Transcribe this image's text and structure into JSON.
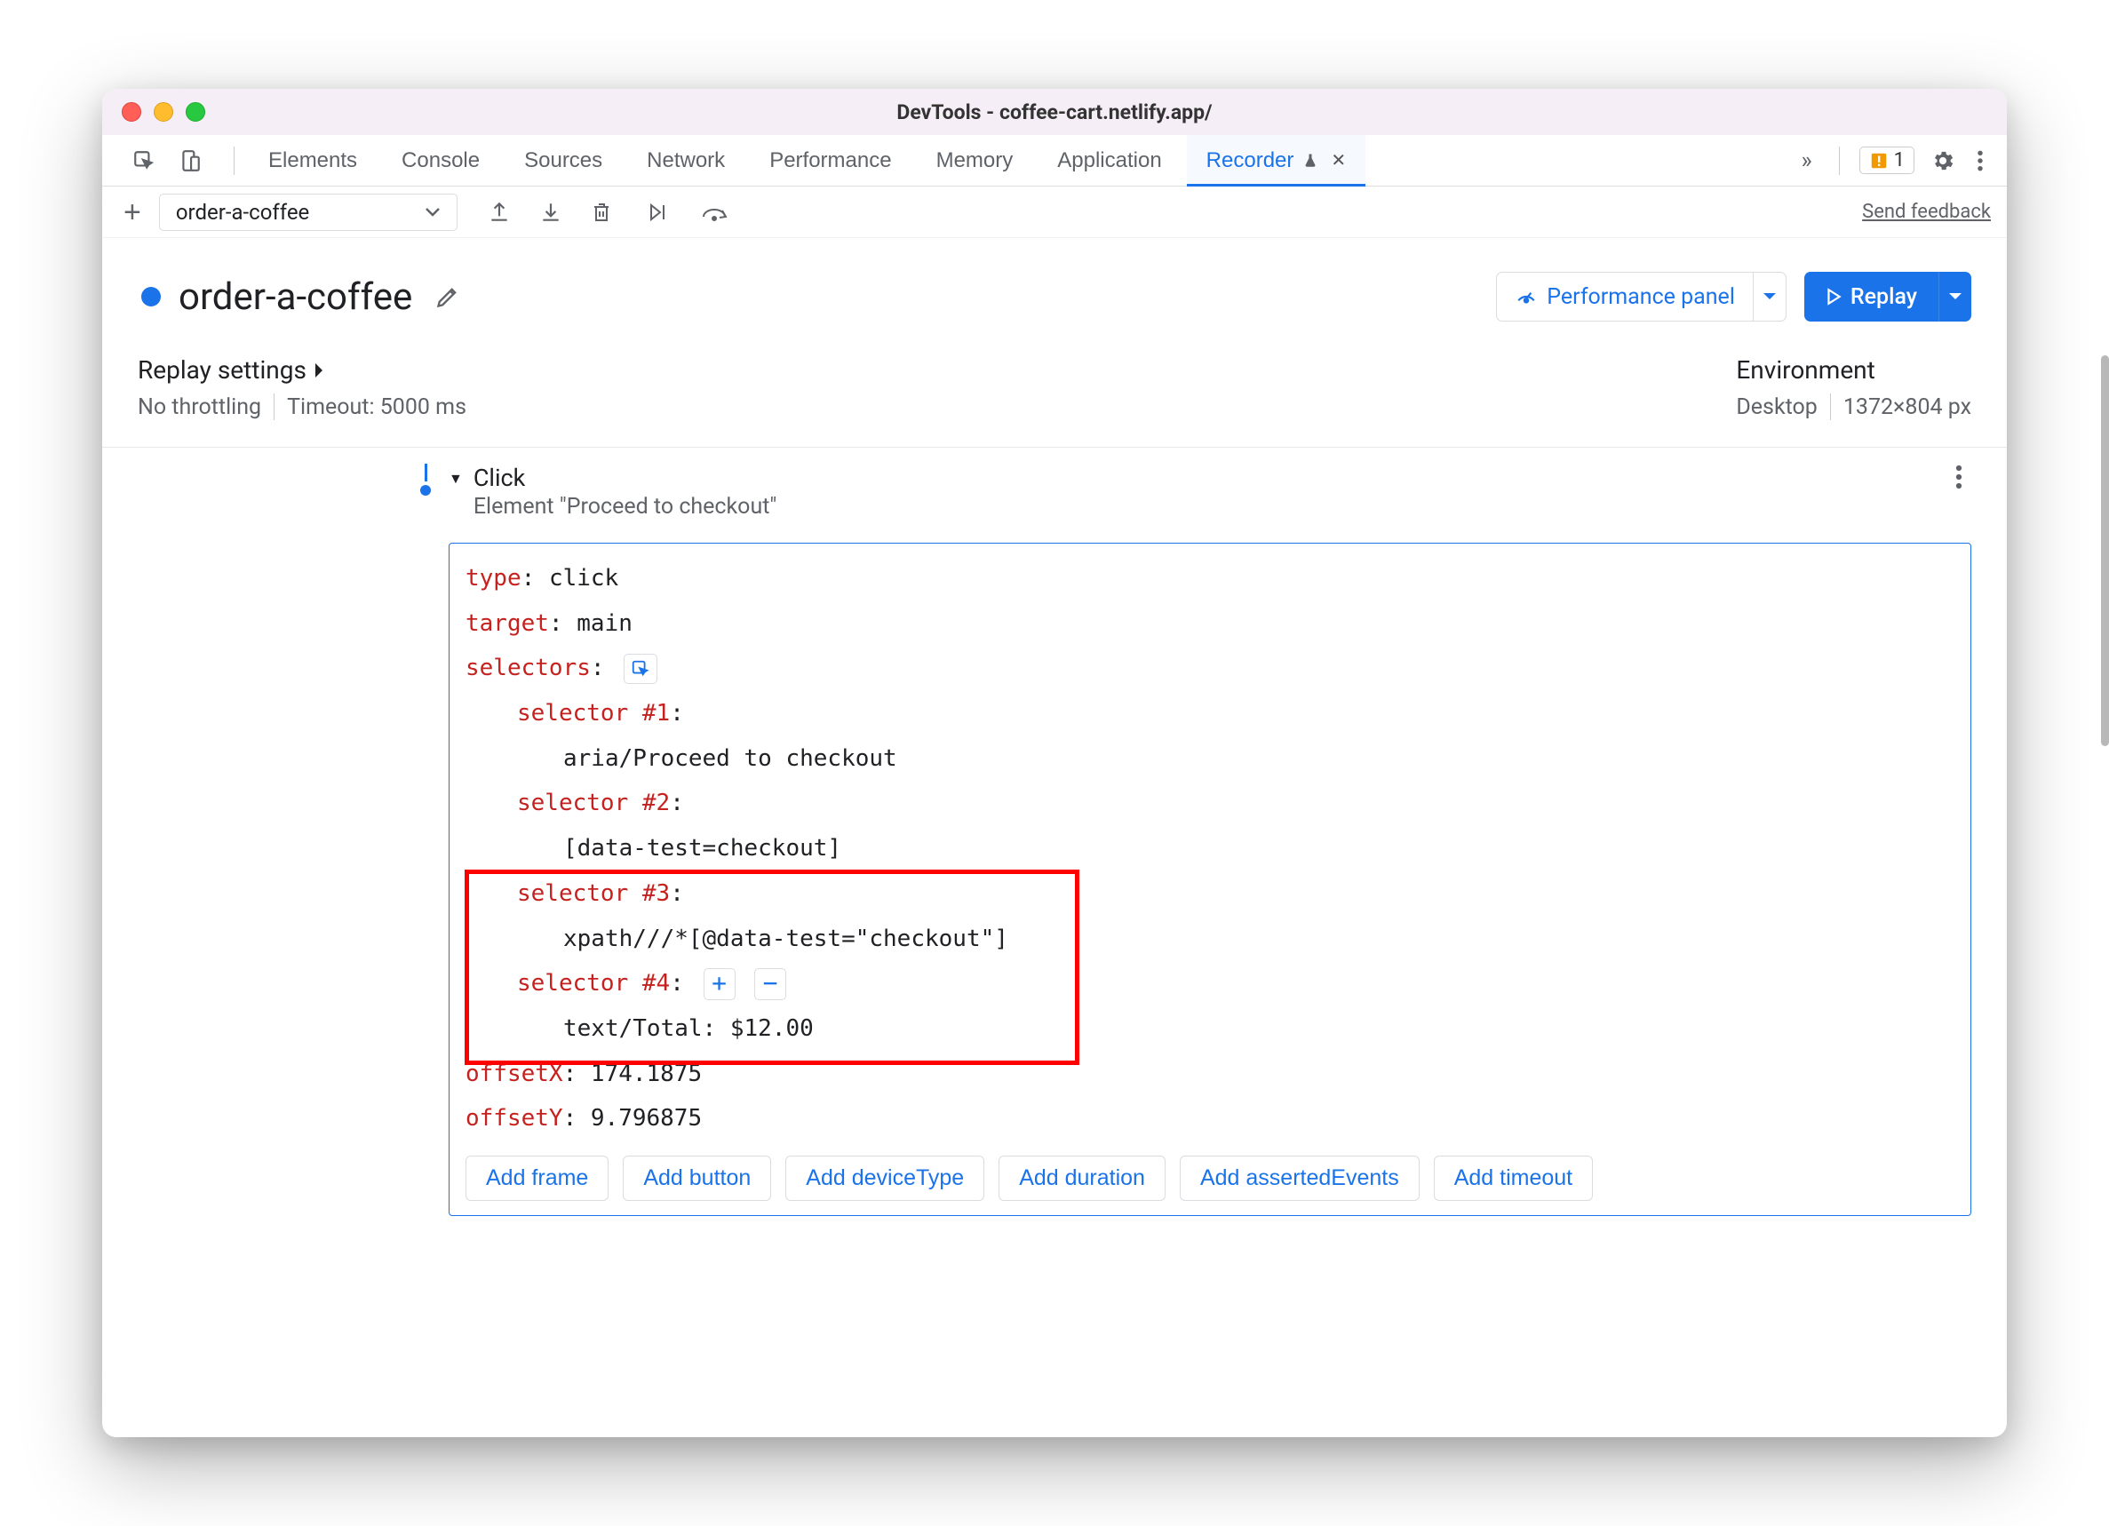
{
  "title": "DevTools - coffee-cart.netlify.app/",
  "tabs": {
    "elements": "Elements",
    "console": "Console",
    "sources": "Sources",
    "network": "Network",
    "performance": "Performance",
    "memory": "Memory",
    "application": "Application",
    "recorder": "Recorder"
  },
  "issues_count": "1",
  "toolbar": {
    "recording_name": "order-a-coffee",
    "send_feedback": "Send feedback"
  },
  "header": {
    "recording_name": "order-a-coffee",
    "performance_panel": "Performance panel",
    "replay": "Replay"
  },
  "replay_settings": {
    "title": "Replay settings",
    "throttling": "No throttling",
    "timeout": "Timeout: 5000 ms"
  },
  "environment": {
    "title": "Environment",
    "device": "Desktop",
    "dimensions": "1372×804 px"
  },
  "step": {
    "name": "Click",
    "subtitle": "Element \"Proceed to checkout\"",
    "type_key": "type",
    "type_val": "click",
    "target_key": "target",
    "target_val": "main",
    "selectors_key": "selectors",
    "sel1_key": "selector #1",
    "sel1_val": "aria/Proceed to checkout",
    "sel2_key": "selector #2",
    "sel2_val": "[data-test=checkout]",
    "sel3_key": "selector #3",
    "sel3_val": "xpath///*[@data-test=\"checkout\"]",
    "sel4_key": "selector #4",
    "sel4_val": "text/Total: $12.00",
    "offsetx_key": "offsetX",
    "offsetx_val": "174.1875",
    "offsety_key": "offsetY",
    "offsety_val": "9.796875"
  },
  "add_buttons": {
    "frame": "Add frame",
    "button": "Add button",
    "deviceType": "Add deviceType",
    "duration": "Add duration",
    "assertedEvents": "Add assertedEvents",
    "timeout": "Add timeout"
  }
}
